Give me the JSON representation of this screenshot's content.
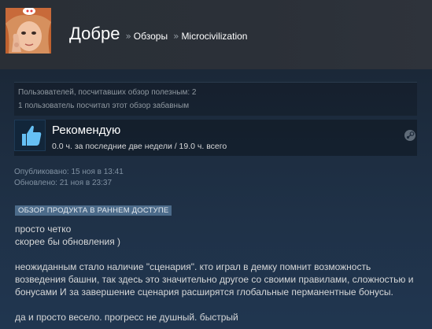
{
  "header": {
    "username": "Добре",
    "separator": "»",
    "crumb_reviews": "Обзоры",
    "crumb_game": "Microcivilization"
  },
  "votes": {
    "helpful": "Пользователей, посчитавших обзор полезным: 2",
    "funny": "1 пользователь посчитал этот обзор забавным"
  },
  "recommendation": {
    "title": "Рекомендую",
    "playtime": "0.0 ч. за последние две недели / 19.0 ч. всего",
    "icon": "thumbs-up-icon",
    "platform_icon": "steam-icon"
  },
  "dates": {
    "published": "Опубликовано: 15 ноя в 13:41",
    "updated": "Обновлено: 21 ноя в 23:37"
  },
  "badge": "ОБЗОР ПРОДУКТА В РАННЕМ ДОСТУПЕ",
  "review": {
    "p1_l1": "просто четко",
    "p1_l2": "скорее бы обновления )",
    "p2": "неожиданным стало наличие \"сценария\". кто играл в демку помнит возможность возведения башни, так здесь это значительно другое со своими правилами, сложностью и бонусами И за завершение сценария расширятся глобальные перманентные бонусы.",
    "p3": "да и просто весело. прогресс не душный. быстрый"
  },
  "colors": {
    "background": "#1b2838",
    "header": "#2a2f36",
    "badge": "#4c6b8a",
    "thumb_blue": "#66c0f4"
  }
}
